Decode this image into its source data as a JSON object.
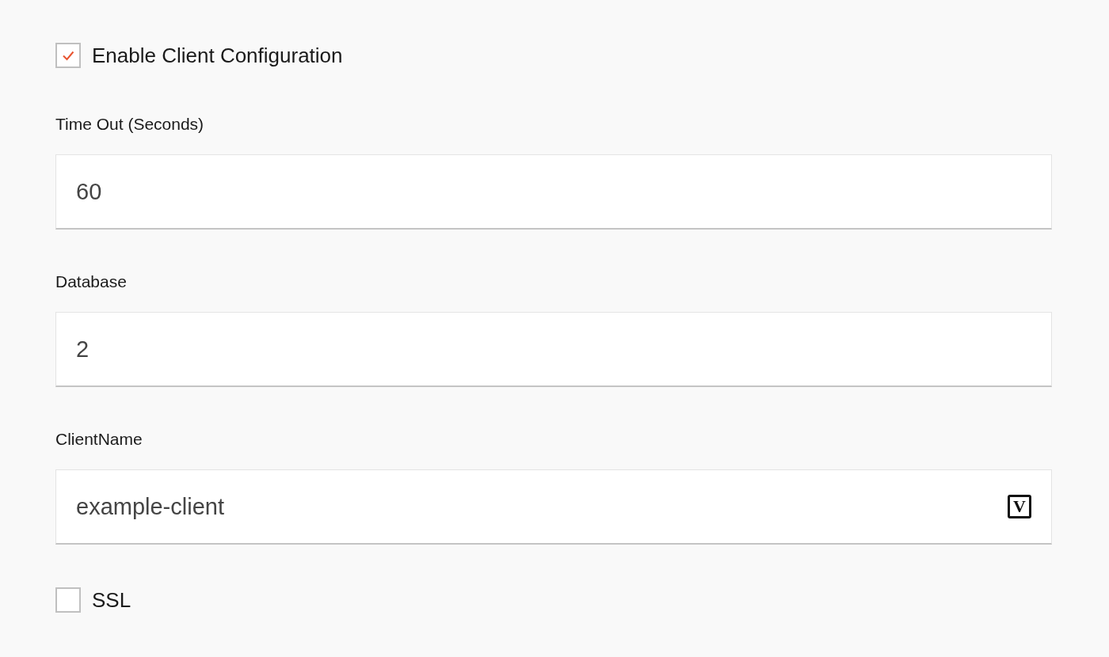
{
  "settings": [
    {
      "kind": "checkbox",
      "label": "Enable Client Configuration",
      "checked": true
    },
    {
      "kind": "field",
      "label": "Time Out (Seconds)",
      "value": "60"
    },
    {
      "kind": "field",
      "label": "Database",
      "value": "2"
    },
    {
      "kind": "field",
      "label": "ClientName",
      "value": "example-client",
      "badge": "V"
    },
    {
      "kind": "checkbox",
      "label": "SSL",
      "checked": false
    }
  ]
}
